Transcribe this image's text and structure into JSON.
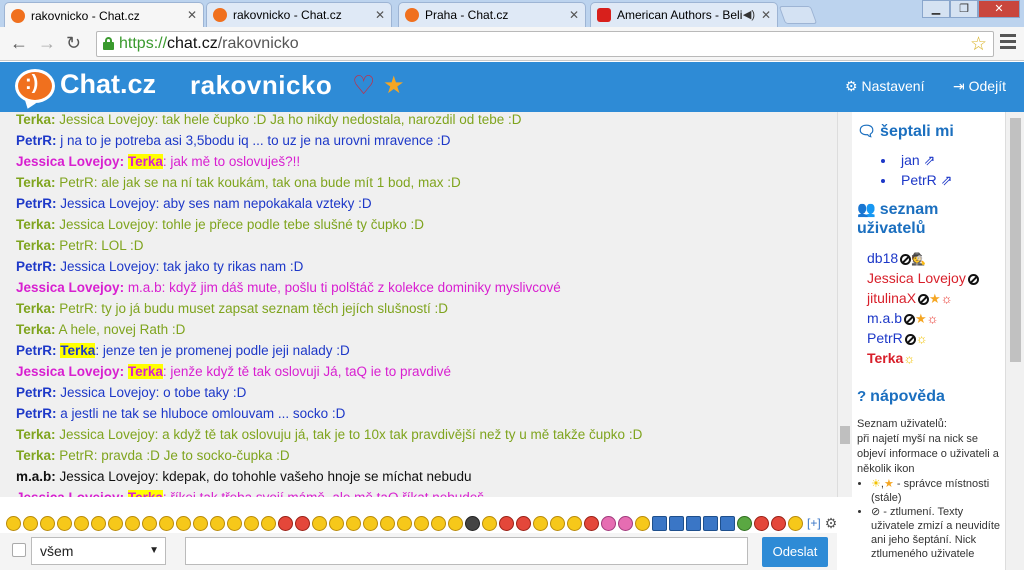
{
  "browser": {
    "tabs": [
      {
        "title": "rakovnicko - Chat.cz",
        "icon": "chat-icon",
        "active": true
      },
      {
        "title": "rakovnicko - Chat.cz",
        "icon": "chat-icon",
        "active": false
      },
      {
        "title": "Praha - Chat.cz",
        "icon": "chat-icon",
        "active": false
      },
      {
        "title": "American Authors - Believ",
        "icon": "youtube-icon",
        "active": false
      }
    ],
    "url_prefix": "https://",
    "url_host": "chat.cz",
    "url_path": "/rakovnicko"
  },
  "header": {
    "brand": "Chat.cz",
    "room": "rakovnicko",
    "settings": "Nastavení",
    "logout": "Odejít"
  },
  "colors": {
    "terka": "#7fa41e",
    "petr": "#1d38c8",
    "jessica": "#d81fd0",
    "mab": "#111111",
    "accent": "#2e8bd6"
  },
  "messages": [
    {
      "nick": "Terka:",
      "text": " Jessica Lovejoy: tak hele čupko :D Ja ho nikdy nedostala, narozdil od tebe :D",
      "color": "#7fa41e"
    },
    {
      "nick": "PetrR:",
      "text": " j na to je potreba asi 3,5bodu iq ... to uz je na urovni mravence :D",
      "color": "#1d38c8"
    },
    {
      "nick": "Jessica Lovejoy:",
      "hl": "Terka",
      "text": ": jak mě to oslovuješ?!!",
      "color": "#d81fd0"
    },
    {
      "nick": "Terka:",
      "text": " PetrR: ale jak se na ní tak koukám, tak ona bude mít 1 bod, max :D",
      "color": "#7fa41e"
    },
    {
      "nick": "PetrR:",
      "text": " Jessica Lovejoy: aby ses nam nepokakala vzteky :D",
      "color": "#1d38c8"
    },
    {
      "nick": "Terka:",
      "text": " Jessica Lovejoy: tohle je přece podle tebe slušné ty čupko :D",
      "color": "#7fa41e"
    },
    {
      "nick": "Terka:",
      "text": " PetrR: LOL :D",
      "color": "#7fa41e"
    },
    {
      "nick": "PetrR:",
      "text": " Jessica Lovejoy: tak jako ty rikas nam :D",
      "color": "#1d38c8"
    },
    {
      "nick": "Jessica Lovejoy:",
      "text": " m.a.b: když jim dáš mute, pošlu ti polštáč z kolekce dominiky myslivcové",
      "color": "#d81fd0"
    },
    {
      "nick": "Terka:",
      "text": " PetrR: ty jo já budu muset zapsat seznam těch jejích slušností :D",
      "color": "#7fa41e"
    },
    {
      "nick": "Terka:",
      "text": " A hele, novej Rath :D",
      "color": "#7fa41e"
    },
    {
      "nick": "PetrR:",
      "hl": "Terka",
      "text": ": jenze ten je promenej podle jeji nalady :D",
      "color": "#1d38c8"
    },
    {
      "nick": "Jessica Lovejoy:",
      "hl": "Terka",
      "text": ": jenže když tě tak oslovuji Já, taQ ie to pravdivé",
      "color": "#d81fd0"
    },
    {
      "nick": "PetrR:",
      "text": " Jessica Lovejoy: o tobe taky :D",
      "color": "#1d38c8"
    },
    {
      "nick": "PetrR:",
      "text": " a jestli ne tak se hluboce omlouvam ... socko :D",
      "color": "#1d38c8"
    },
    {
      "nick": "Terka:",
      "text": " Jessica Lovejoy: a když tě tak oslovuju já, tak je to 10x tak pravdivější než ty u mě takže čupko :D",
      "color": "#7fa41e"
    },
    {
      "nick": "Terka:",
      "text": " PetrR: pravda :D Je to socko-čupka :D",
      "color": "#7fa41e"
    },
    {
      "nick": "m.a.b:",
      "text": " Jessica Lovejoy: kdepak, do tohohle vašeho hnoje se míchat nebudu",
      "color": "#111111"
    },
    {
      "nick": "Jessica Lovejoy:",
      "hl": "Terka",
      "text": ": říkej tak třeba svojí mámě, ale mě taQ říkat nebudeš",
      "color": "#d81fd0"
    }
  ],
  "sidebar": {
    "whispers_title": "šeptali mi",
    "whispers": [
      "jan",
      "PetrR"
    ],
    "users_title_1": "seznam",
    "users_title_2": "uživatelů",
    "users": [
      {
        "name": "db18",
        "color": "#1d38c8",
        "flags": [
          "ban",
          "agent"
        ]
      },
      {
        "name": "Jessica Lovejoy",
        "color": "#d81f2a",
        "flags": [
          "ban"
        ]
      },
      {
        "name": "jitulinaX",
        "color": "#d81f2a",
        "flags": [
          "ban",
          "star",
          "sun-red"
        ]
      },
      {
        "name": "m.a.b",
        "color": "#1d38c8",
        "flags": [
          "ban",
          "star",
          "sun-red"
        ]
      },
      {
        "name": "PetrR",
        "color": "#1d38c8",
        "flags": [
          "ban",
          "sun"
        ]
      },
      {
        "name": "Terka",
        "color": "#d81f2a",
        "bold": true,
        "flags": [
          "sun"
        ]
      }
    ],
    "help_title": "nápověda",
    "help_intro": "Seznam uživatelů:",
    "help_text": "při najetí myší na nick se objeví informace o uživateli a několik ikon",
    "help_items": [
      " - správce místnosti (stále)",
      " - ztlumení. Texty uživatele zmizí a neuvidíte ani jeho šeptání. Nick ztlumeného uživatele"
    ]
  },
  "composer": {
    "recipient": "všem",
    "more_emoticons": "[+]",
    "send": "Odeslat"
  }
}
